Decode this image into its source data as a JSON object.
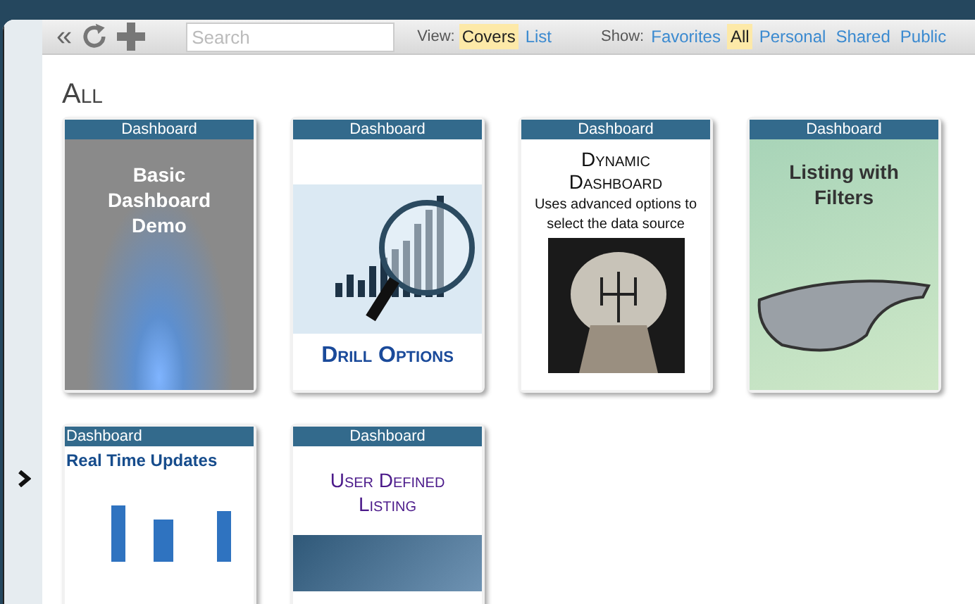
{
  "toolbar": {
    "collapse_glyph": "«",
    "search": {
      "placeholder": "Search"
    },
    "view": {
      "label": "View:",
      "options": [
        {
          "label": "Covers",
          "selected": true
        },
        {
          "label": "List",
          "selected": false
        }
      ]
    },
    "show": {
      "label": "Show:",
      "options": [
        {
          "label": "Favorites",
          "selected": false
        },
        {
          "label": "All",
          "selected": true
        },
        {
          "label": "Personal",
          "selected": false
        },
        {
          "label": "Shared",
          "selected": false
        },
        {
          "label": "Public",
          "selected": false
        }
      ]
    }
  },
  "heading": "All",
  "cards": [
    {
      "kind": "glow",
      "type": "Dashboard",
      "title": "Basic Dashboard Demo"
    },
    {
      "kind": "magnifier",
      "type": "Dashboard",
      "title": "Drill Options"
    },
    {
      "kind": "gearshift",
      "type": "Dashboard",
      "title": "Dynamic Dashboard",
      "subtitle": "Uses advanced options to select the data source"
    },
    {
      "kind": "glasses",
      "type": "Dashboard",
      "title": "Listing with Filters"
    },
    {
      "kind": "cylinders",
      "type": "Dashboard",
      "title": "Real Time Updates"
    },
    {
      "kind": "swirl",
      "type": "Dashboard",
      "title": "User Defined Listing"
    }
  ]
}
